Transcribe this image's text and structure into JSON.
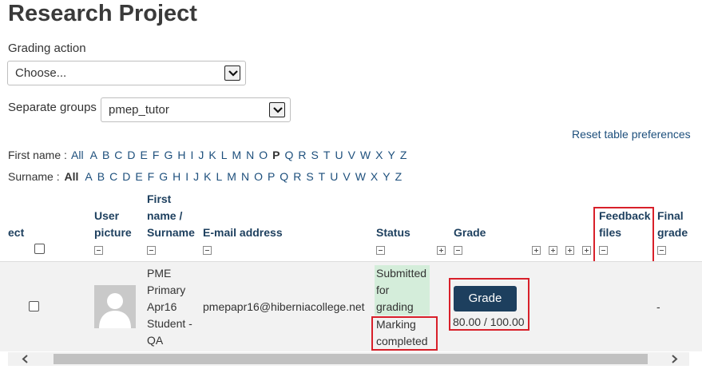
{
  "page": {
    "title": "Research Project"
  },
  "grading_action": {
    "label": "Grading action",
    "selected": "Choose..."
  },
  "groups": {
    "label": "Separate groups",
    "selected": "pmep_tutor"
  },
  "reset_link": "Reset table preferences",
  "first_name_filter": {
    "label": "First name :",
    "all": "All",
    "letters": [
      "A",
      "B",
      "C",
      "D",
      "E",
      "F",
      "G",
      "H",
      "I",
      "J",
      "K",
      "L",
      "M",
      "N",
      "O",
      "P",
      "Q",
      "R",
      "S",
      "T",
      "U",
      "V",
      "W",
      "X",
      "Y",
      "Z"
    ],
    "selected": "P"
  },
  "surname_filter": {
    "label": "Surname :",
    "all": "All",
    "letters": [
      "A",
      "B",
      "C",
      "D",
      "E",
      "F",
      "G",
      "H",
      "I",
      "J",
      "K",
      "L",
      "M",
      "N",
      "O",
      "P",
      "Q",
      "R",
      "S",
      "T",
      "U",
      "V",
      "W",
      "X",
      "Y",
      "Z"
    ],
    "selected": "All"
  },
  "table": {
    "headers": {
      "select": "ect",
      "user_picture_1": "User",
      "user_picture_2": "picture",
      "name_1": "First",
      "name_2": "name /",
      "name_3": "Surname",
      "email": "E-mail address",
      "status": "Status",
      "grade": "Grade",
      "feedback_1": "Feedback",
      "feedback_2": "files",
      "final_1": "Final",
      "final_2": "grade"
    },
    "row": {
      "name_lines": [
        "PME",
        "Primary",
        "Apr16",
        "Student -",
        "QA"
      ],
      "email": "pmepapr16@hiberniacollege.net",
      "status_submitted": [
        "Submitted",
        "for",
        "grading"
      ],
      "status_marking": [
        "Marking",
        "completed"
      ],
      "grade_button": "Grade",
      "grade_value": "80.00 / 100.00",
      "final_grade": "-"
    }
  },
  "colors": {
    "link": "#1d4f7c",
    "header_text": "#1d3f5e",
    "grade_button": "#1d3f5e",
    "submitted_bg": "#d4edda",
    "highlight": "#d8202a"
  }
}
